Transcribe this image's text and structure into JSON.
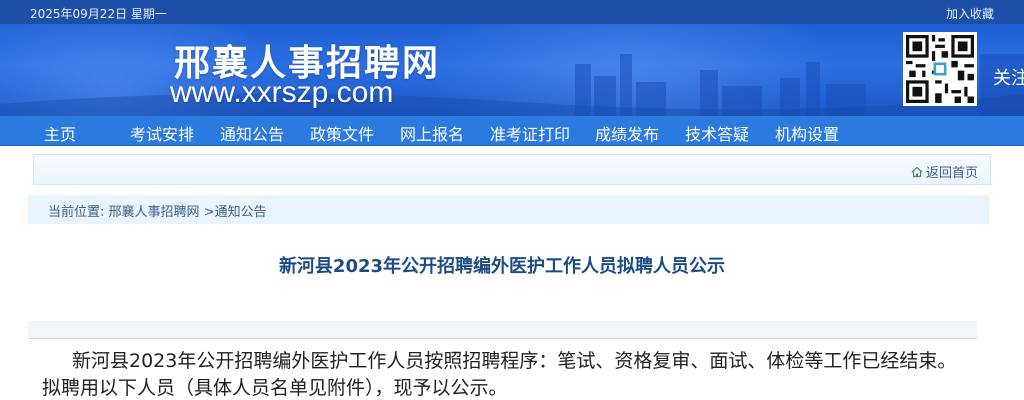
{
  "topbar": {
    "date": "2025年09月22日 星期一",
    "favorite": "加入收藏"
  },
  "header": {
    "title": "邢襄人事招聘网",
    "url": "www.xxrszp.com",
    "qr_icon": "qr-code-icon",
    "follow_text": "关注"
  },
  "nav": {
    "items": [
      {
        "label": "主页"
      },
      {
        "label": "考试安排"
      },
      {
        "label": "通知公告"
      },
      {
        "label": "政策文件"
      },
      {
        "label": "网上报名"
      },
      {
        "label": "准考证打印"
      },
      {
        "label": "成绩发布"
      },
      {
        "label": "技术答疑"
      },
      {
        "label": "机构设置"
      }
    ]
  },
  "back_home": {
    "label": "返回首页",
    "icon": "home-icon"
  },
  "breadcrumb": {
    "prefix": "当前位置:",
    "home": "邢襄人事招聘网",
    "sep": ">",
    "current": "通知公告"
  },
  "article": {
    "title": "新河县2023年公开招聘编外医护工作人员拟聘人员公示",
    "paragraph": "新河县2023年公开招聘编外医护工作人员按照招聘程序：笔试、资格复审、面试、体检等工作已经结束。拟聘用以下人员（具体人员名单见附件），现予以公示。"
  },
  "colors": {
    "topbar": "#1d4fa8",
    "banner": "#2b6fe0",
    "nav": "#2b7ae0",
    "title": "#1d4c85"
  }
}
